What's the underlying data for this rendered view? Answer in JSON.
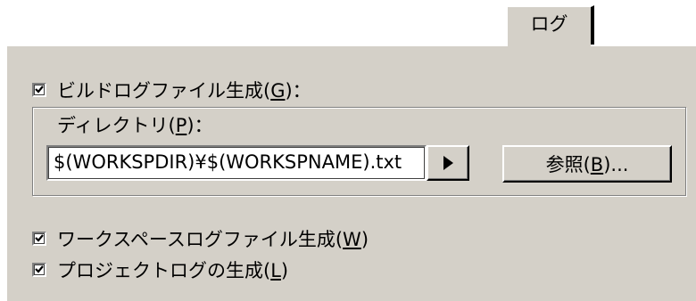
{
  "tabs": [
    {
      "label": "ログ",
      "active": true
    }
  ],
  "build_log": {
    "checked": true,
    "label_pre": "ビルドログファイル生成(",
    "accel": "G",
    "label_post": ")："
  },
  "directory": {
    "label_pre": "ディレクトリ(",
    "accel": "P",
    "label_post": ")：",
    "path_value": "$(WORKSPDIR)¥$(WORKSPNAME).txt"
  },
  "macro_button": {
    "icon": "right-triangle-icon"
  },
  "browse_button": {
    "label_pre": "参照(",
    "accel": "B",
    "label_post": ")..."
  },
  "workspace_log": {
    "checked": true,
    "label_pre": "ワークスペースログファイル生成(",
    "accel": "W",
    "label_post": ")"
  },
  "project_log": {
    "checked": true,
    "label_pre": "プロジェクトログの生成(",
    "accel": "L",
    "label_post": ")"
  },
  "colors": {
    "dialog_face": "#d4d0c8",
    "field_bg": "#ffffff"
  }
}
